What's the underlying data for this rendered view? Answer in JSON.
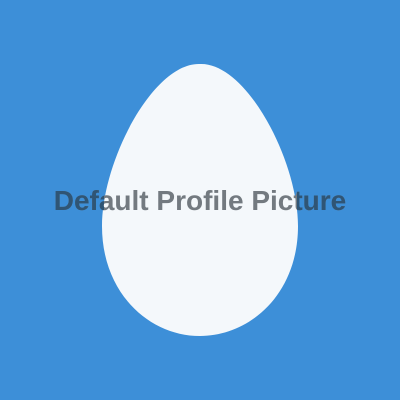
{
  "avatar": {
    "label": "Default Profile Picture",
    "icon": "egg-icon",
    "colors": {
      "background": "#3d8fd8",
      "egg": "#f4f8fb",
      "text_on_egg": "#737a80",
      "text_on_background": "#2f5575"
    }
  }
}
